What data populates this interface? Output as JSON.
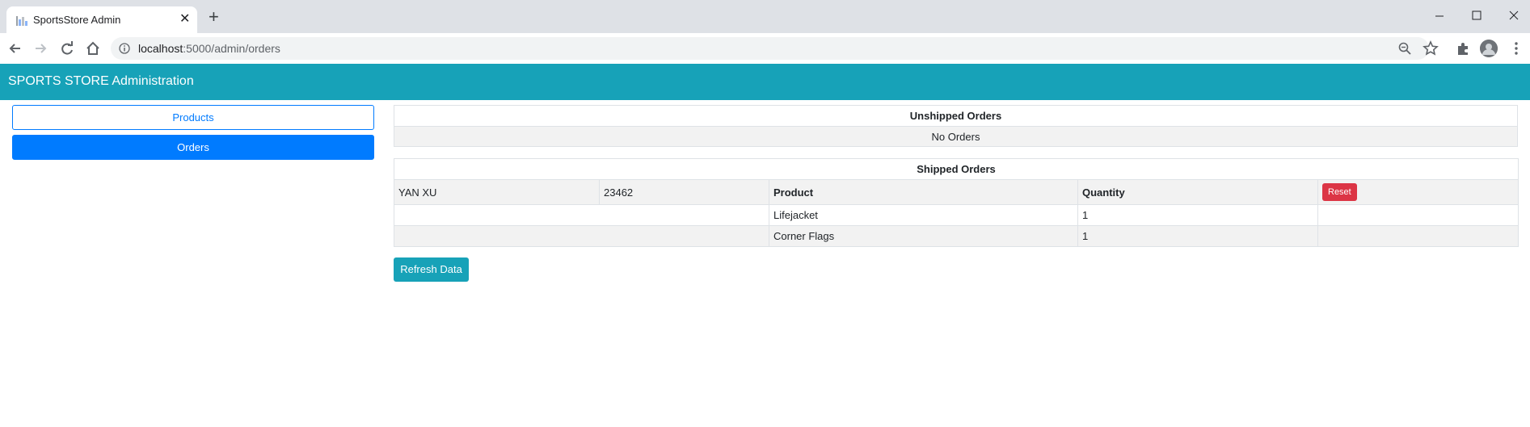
{
  "browser": {
    "tab_title": "SportsStore Admin",
    "tab_close": "✕",
    "new_tab": "+",
    "url_host": "localhost",
    "url_path": ":5000/admin/orders"
  },
  "header": {
    "title": "SPORTS STORE Administration"
  },
  "sidebar": {
    "products_label": "Products",
    "orders_label": "Orders"
  },
  "unshipped": {
    "title": "Unshipped Orders",
    "empty_text": "No Orders"
  },
  "shipped": {
    "title": "Shipped Orders",
    "order": {
      "customer": "YAN XU",
      "zip": "23462",
      "product_header": "Product",
      "quantity_header": "Quantity",
      "reset_label": "Reset",
      "lines": [
        {
          "product": "Lifejacket",
          "quantity": "1"
        },
        {
          "product": "Corner Flags",
          "quantity": "1"
        }
      ]
    }
  },
  "actions": {
    "refresh_label": "Refresh Data"
  },
  "colors": {
    "header": "#17a2b8",
    "primary": "#007bff",
    "danger": "#dc3545"
  }
}
